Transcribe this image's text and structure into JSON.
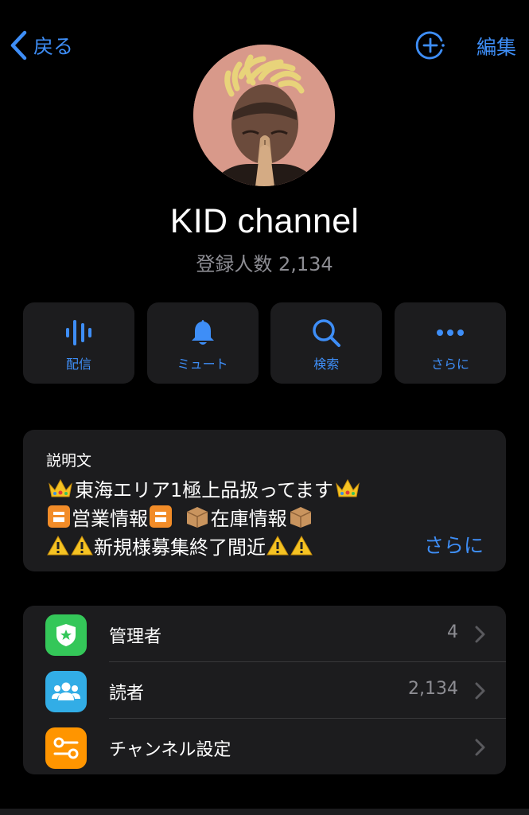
{
  "nav": {
    "back_label": "戻る",
    "add_icon": "add-circle-icon",
    "edit_label": "編集"
  },
  "colors": {
    "accent": "#3e8ef7",
    "background": "#000000",
    "card": "#1c1c1e",
    "secondary_text": "#8d8d93",
    "admins_icon_bg": "#34c759",
    "subscribers_icon_bg": "#32ade6",
    "settings_icon_bg": "#ff9500"
  },
  "channel": {
    "name": "KID channel",
    "subscriber_label": "登録人数 2,134"
  },
  "actions": [
    {
      "label": "配信",
      "icon": "broadcast-icon"
    },
    {
      "label": "ミュート",
      "icon": "bell-icon"
    },
    {
      "label": "検索",
      "icon": "search-icon"
    },
    {
      "label": "さらに",
      "icon": "more-icon"
    }
  ],
  "description": {
    "title": "説明文",
    "line1": "東海エリア1極上品扱ってます",
    "line2a": "営業情報",
    "line2b": "在庫情報",
    "line3": "新規様募集終了間近",
    "more_label": "さらに"
  },
  "list": [
    {
      "label": "管理者",
      "value": "4",
      "icon": "admin-badge-icon"
    },
    {
      "label": "読者",
      "value": "2,134",
      "icon": "people-icon"
    },
    {
      "label": "チャンネル設定",
      "value": "",
      "icon": "settings-toggle-icon"
    }
  ]
}
